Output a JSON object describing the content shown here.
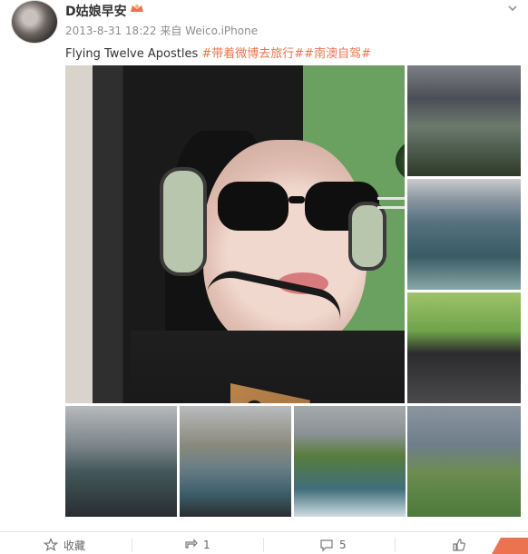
{
  "post": {
    "author": "D姑娘早安",
    "timestamp": "2013-8-31 18:22",
    "source_prefix": "来自",
    "source": "Weico.iPhone",
    "text": "Flying Twelve Apostles",
    "tags": [
      "#带着微博去旅行#",
      "#南澳自驾#"
    ]
  },
  "actions": {
    "favorite_label": "收藏",
    "repost_count": "1",
    "comment_count": "5"
  },
  "colors": {
    "accent": "#eb7350",
    "meta_gray": "#8d8d8d"
  }
}
